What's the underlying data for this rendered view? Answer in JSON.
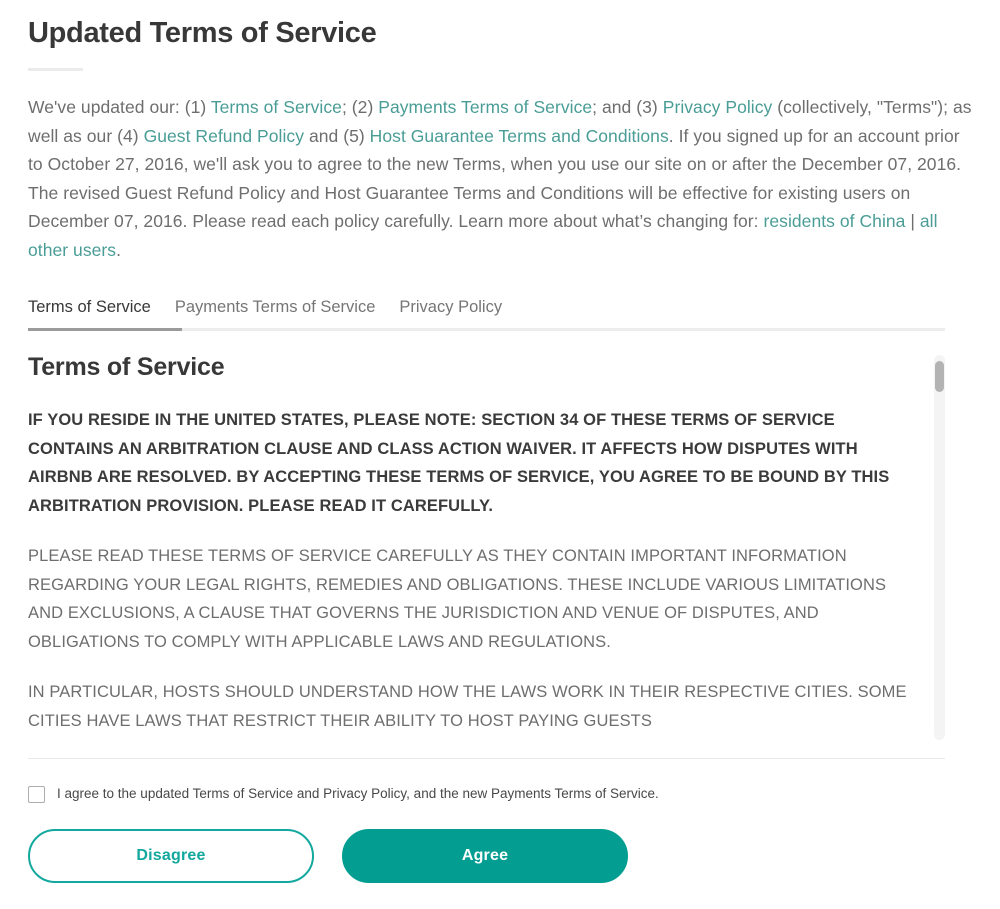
{
  "header": {
    "title": "Updated Terms of Service"
  },
  "intro": {
    "s1": "We've updated our: (1) ",
    "link1": "Terms of Service",
    "s2": "; (2) ",
    "link2": "Payments Terms of Service",
    "s3": "; and (3) ",
    "link3": "Privacy Policy",
    "s4": " (collectively, \"Terms\"); as well as our (4) ",
    "link4": "Guest Refund Policy",
    "s5": " and (5) ",
    "link5": "Host Guarantee Terms and Conditions",
    "s6": ". If you signed up for an account prior to October 27, 2016, we'll ask you to agree to the new Terms, when you use our site on or after the December 07, 2016. The revised Guest Refund Policy and Host Guarantee Terms and Conditions will be effective for existing users on December 07, 2016. Please read each policy carefully. Learn more about what’s changing for: ",
    "link6": "residents of China",
    "divider": " | ",
    "link7": "all other users",
    "s7": "."
  },
  "tabs": {
    "items": [
      {
        "label": "Terms of Service",
        "active": true
      },
      {
        "label": "Payments Terms of Service",
        "active": false
      },
      {
        "label": "Privacy Policy",
        "active": false
      }
    ]
  },
  "document": {
    "heading": "Terms of Service",
    "notice": "IF YOU RESIDE IN THE UNITED STATES, PLEASE NOTE: SECTION 34 OF THESE TERMS OF SERVICE CONTAINS AN ARBITRATION CLAUSE AND CLASS ACTION WAIVER. IT AFFECTS HOW DISPUTES WITH AIRBNB ARE RESOLVED. BY ACCEPTING THESE TERMS OF SERVICE, YOU AGREE TO BE BOUND BY THIS ARBITRATION PROVISION. PLEASE READ IT CAREFULLY.",
    "paragraph1": "PLEASE READ THESE TERMS OF SERVICE CAREFULLY AS THEY CONTAIN IMPORTANT INFORMATION REGARDING YOUR LEGAL RIGHTS, REMEDIES AND OBLIGATIONS. THESE INCLUDE VARIOUS LIMITATIONS AND EXCLUSIONS, A CLAUSE THAT GOVERNS THE JURISDICTION AND VENUE OF DISPUTES, AND OBLIGATIONS TO COMPLY WITH APPLICABLE LAWS AND REGULATIONS.",
    "paragraph2": "IN PARTICULAR, HOSTS SHOULD UNDERSTAND HOW THE LAWS WORK IN THEIR RESPECTIVE CITIES. SOME CITIES HAVE LAWS THAT RESTRICT THEIR ABILITY TO HOST PAYING GUESTS"
  },
  "footer": {
    "agree_checkbox_label": "I agree to the updated Terms of Service and Privacy Policy, and the new Payments Terms of Service.",
    "agree_checked": false,
    "disagree_label": "Disagree",
    "agree_label": "Agree"
  },
  "colors": {
    "brand_teal": "#049d92",
    "link_teal": "#4a9d96",
    "text_gray": "#6e6e6e",
    "heading_gray": "#383838"
  }
}
